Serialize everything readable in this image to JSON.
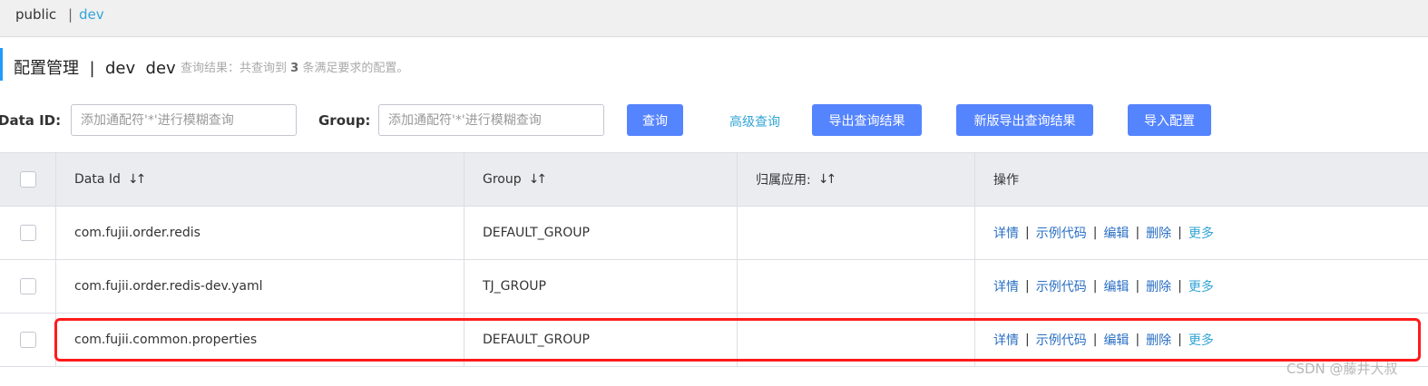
{
  "namespace": {
    "items": [
      {
        "label": "public"
      },
      {
        "separator": "|",
        "label": "dev"
      }
    ]
  },
  "header": {
    "title": "配置管理  |  dev  dev",
    "query_result_prefix": "查询结果：共查询到",
    "query_count": "3",
    "query_result_suffix": "条满足要求的配置。"
  },
  "filters": {
    "data_id_label": "Data ID:",
    "data_id_placeholder": "添加通配符'*'进行模糊查询",
    "group_label": "Group:",
    "group_placeholder": "添加通配符'*'进行模糊查询"
  },
  "actions": {
    "search": "查询",
    "advanced_search": "高级查询",
    "export": "导出查询结果",
    "new_export": "新版导出查询结果",
    "import": "导入配置"
  },
  "table": {
    "columns": [
      "Data Id",
      "Group",
      "归属应用:",
      "操作"
    ],
    "sort_icon": "↓↑",
    "rows": [
      {
        "data_id": "com.fujii.order.redis",
        "group": "DEFAULT_GROUP",
        "app": ""
      },
      {
        "data_id": "com.fujii.order.redis-dev.yaml",
        "group": "TJ_GROUP",
        "app": ""
      },
      {
        "data_id": "com.fujii.common.properties",
        "group": "DEFAULT_GROUP",
        "app": ""
      }
    ],
    "ops": {
      "detail": "详情",
      "sample_code": "示例代码",
      "edit": "编辑",
      "delete": "删除",
      "more": "更多",
      "separator": "|"
    }
  },
  "watermark": "CSDN @藤井大叔",
  "colors": {
    "primary_button": "#5584ff",
    "link": "#2a6fc4",
    "accent_link": "#33a5d6",
    "highlight": "#ff1a1a",
    "header_bg": "#ebecf0"
  }
}
